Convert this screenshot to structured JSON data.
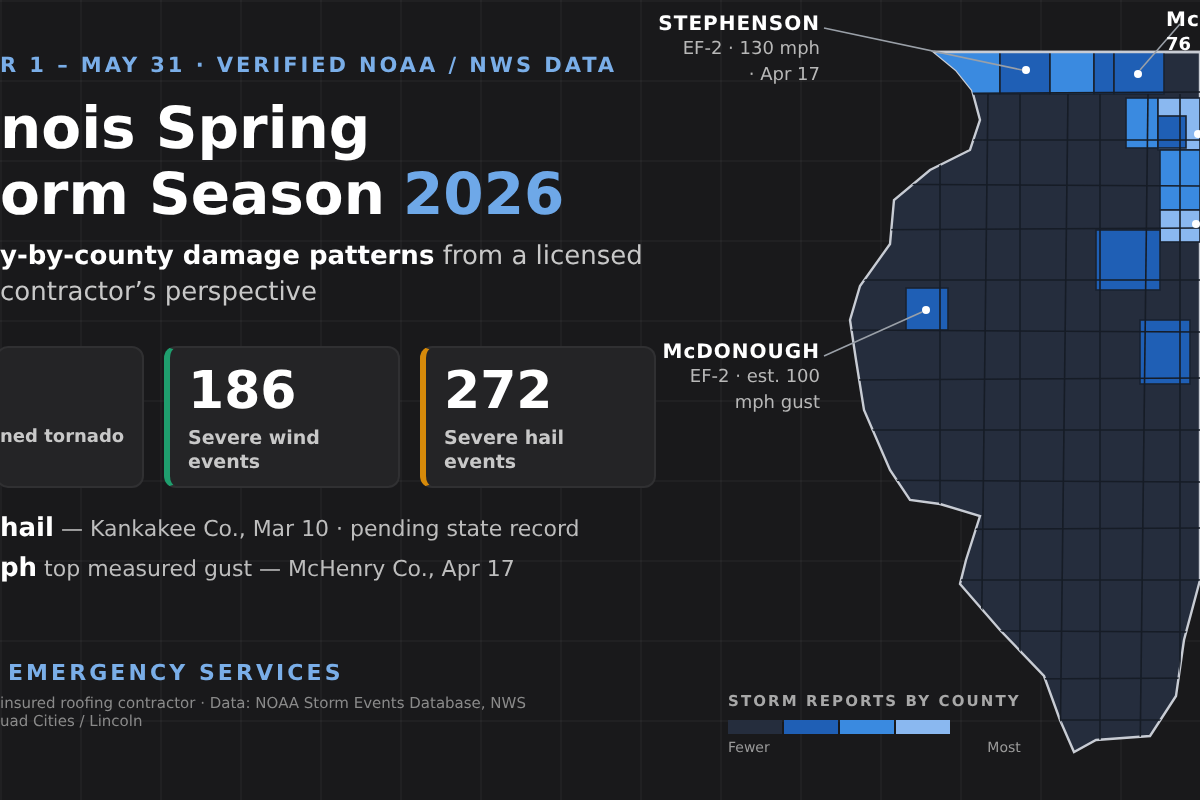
{
  "kicker": "R 1 – MAY 31 · VERIFIED NOAA / NWS DATA",
  "title": {
    "line_1": "nois Spring",
    "line_2": "orm Season",
    "year": "2026"
  },
  "subtitle": {
    "line_1": "**y-by-county damage patterns** from a licensed",
    "line_2": "contractor’s perspective"
  },
  "stats": [
    {
      "label": "ned tornado"
    },
    {
      "value": "186",
      "label": "Severe wind events",
      "color": "#1f9e6e"
    },
    {
      "value": "272",
      "label": "Severe hail events",
      "color": "#d68a0a"
    }
  ],
  "highlights": [
    "**hail** — Kankakee Co., Mar 10 · pending state record",
    "**ph** top measured gust — McHenry Co., Apr 17"
  ],
  "footer": {
    "title": "EMERGENCY SERVICES",
    "note_1": "insured roofing contractor · Data: NOAA Storm Events Database, NWS",
    "note_2": "uad Cities / Lincoln"
  },
  "annotations": [
    {
      "name": "STEPHENSON",
      "detail_1": "EF-2 · 130 mph",
      "detail_2": "· Apr 17"
    },
    {
      "name": "McDONOUGH",
      "detail_1": "EF-2 · est. 100",
      "detail_2": "mph gust"
    },
    {
      "name": "Mc",
      "detail_1": "76"
    }
  ],
  "legend": {
    "title": "STORM REPORTS BY COUNTY",
    "swatches": [
      {
        "color": "#252d3d"
      },
      {
        "color": "#1f5fb5"
      },
      {
        "color": "#3a8ae0"
      },
      {
        "color": "#8ab8f0"
      }
    ],
    "low": "Fewer",
    "high": "Most"
  }
}
